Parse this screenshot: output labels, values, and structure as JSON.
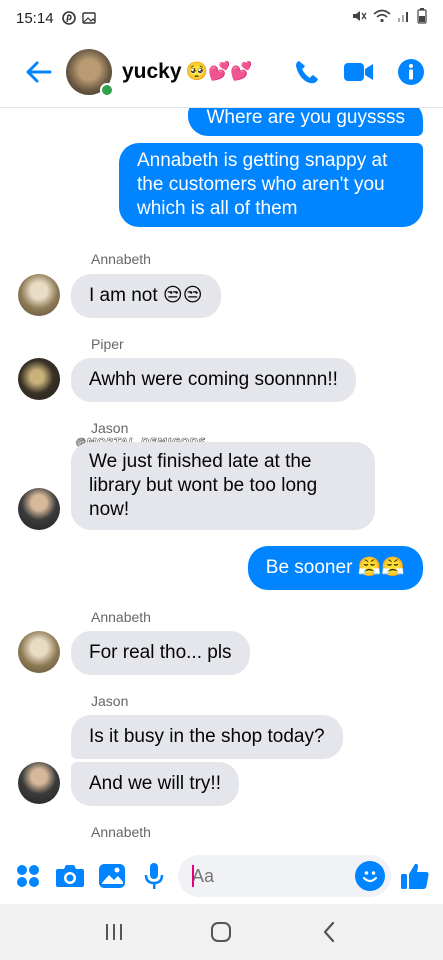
{
  "status_bar": {
    "time": "15:14"
  },
  "header": {
    "contact_name": "yucky",
    "title_emoji": "🥺💕💕"
  },
  "messages": [
    {
      "id": "m1",
      "direction": "out",
      "text": "Where are you guyssss"
    },
    {
      "id": "m2",
      "direction": "out",
      "text": "Annabeth is getting snappy at the customers who aren't you which is all of them"
    },
    {
      "id": "m3",
      "direction": "in",
      "sender": "Annabeth",
      "text": "I am not 😒😒"
    },
    {
      "id": "m4",
      "direction": "in",
      "sender": "Piper",
      "text": "Awhh were coming soonnnn!!"
    },
    {
      "id": "m5",
      "direction": "in",
      "sender": "Jason",
      "text": "We just finished late at the library but wont be too long now!"
    },
    {
      "id": "m6",
      "direction": "out",
      "text": "Be sooner 😤😤"
    },
    {
      "id": "m7",
      "direction": "in",
      "sender": "Annabeth",
      "text": "For real tho... pls"
    },
    {
      "id": "m8",
      "direction": "in",
      "sender": "Jason",
      "text": "Is it busy in the shop today?"
    },
    {
      "id": "m9",
      "direction": "in",
      "sender": "Jason",
      "text": "And we will try!!"
    },
    {
      "id": "m10",
      "direction": "in",
      "sender": "Annabeth",
      "text": ""
    }
  ],
  "watermark": "@MORTAL_DEMIGODS",
  "composer": {
    "placeholder": "Aa"
  },
  "colors": {
    "accent": "#0084ff",
    "incoming_bubble": "#e4e6eb",
    "online": "#31a24c"
  },
  "icons": [
    "back-arrow-icon",
    "phone-icon",
    "video-icon",
    "info-icon",
    "apps-icon",
    "camera-icon",
    "gallery-icon",
    "microphone-icon",
    "emoji-icon",
    "thumbs-up-icon",
    "recents-nav-icon",
    "home-nav-icon",
    "back-nav-icon"
  ]
}
